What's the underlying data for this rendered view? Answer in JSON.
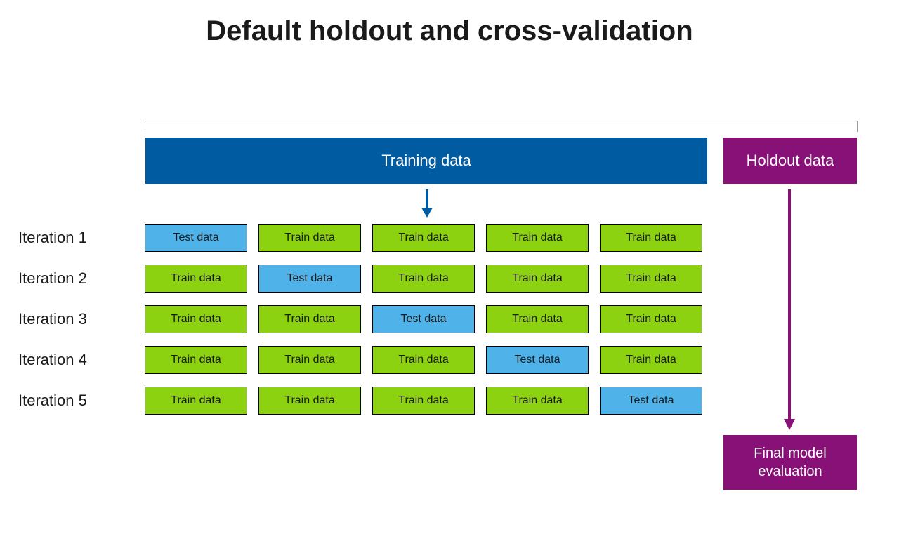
{
  "title": "Default holdout and cross-validation",
  "training_label": "Training data",
  "holdout_label": "Holdout data",
  "iterations": [
    {
      "label": "Iteration 1",
      "cells": [
        "Test data",
        "Train data",
        "Train data",
        "Train data",
        "Train data"
      ]
    },
    {
      "label": "Iteration 2",
      "cells": [
        "Train data",
        "Test data",
        "Train data",
        "Train data",
        "Train data"
      ]
    },
    {
      "label": "Iteration 3",
      "cells": [
        "Train data",
        "Train data",
        "Test data",
        "Train data",
        "Train data"
      ]
    },
    {
      "label": "Iteration 4",
      "cells": [
        "Train data",
        "Train data",
        "Train data",
        "Test data",
        "Train data"
      ]
    },
    {
      "label": "Iteration 5",
      "cells": [
        "Train data",
        "Train data",
        "Train data",
        "Train data",
        "Test data"
      ]
    }
  ],
  "test_label": "Test data",
  "final_label": "Final model evaluation",
  "colors": {
    "training_bar": "#005ba1",
    "holdout_bar": "#881177",
    "train_cell": "#8cd211",
    "test_cell": "#4fb3ea"
  }
}
